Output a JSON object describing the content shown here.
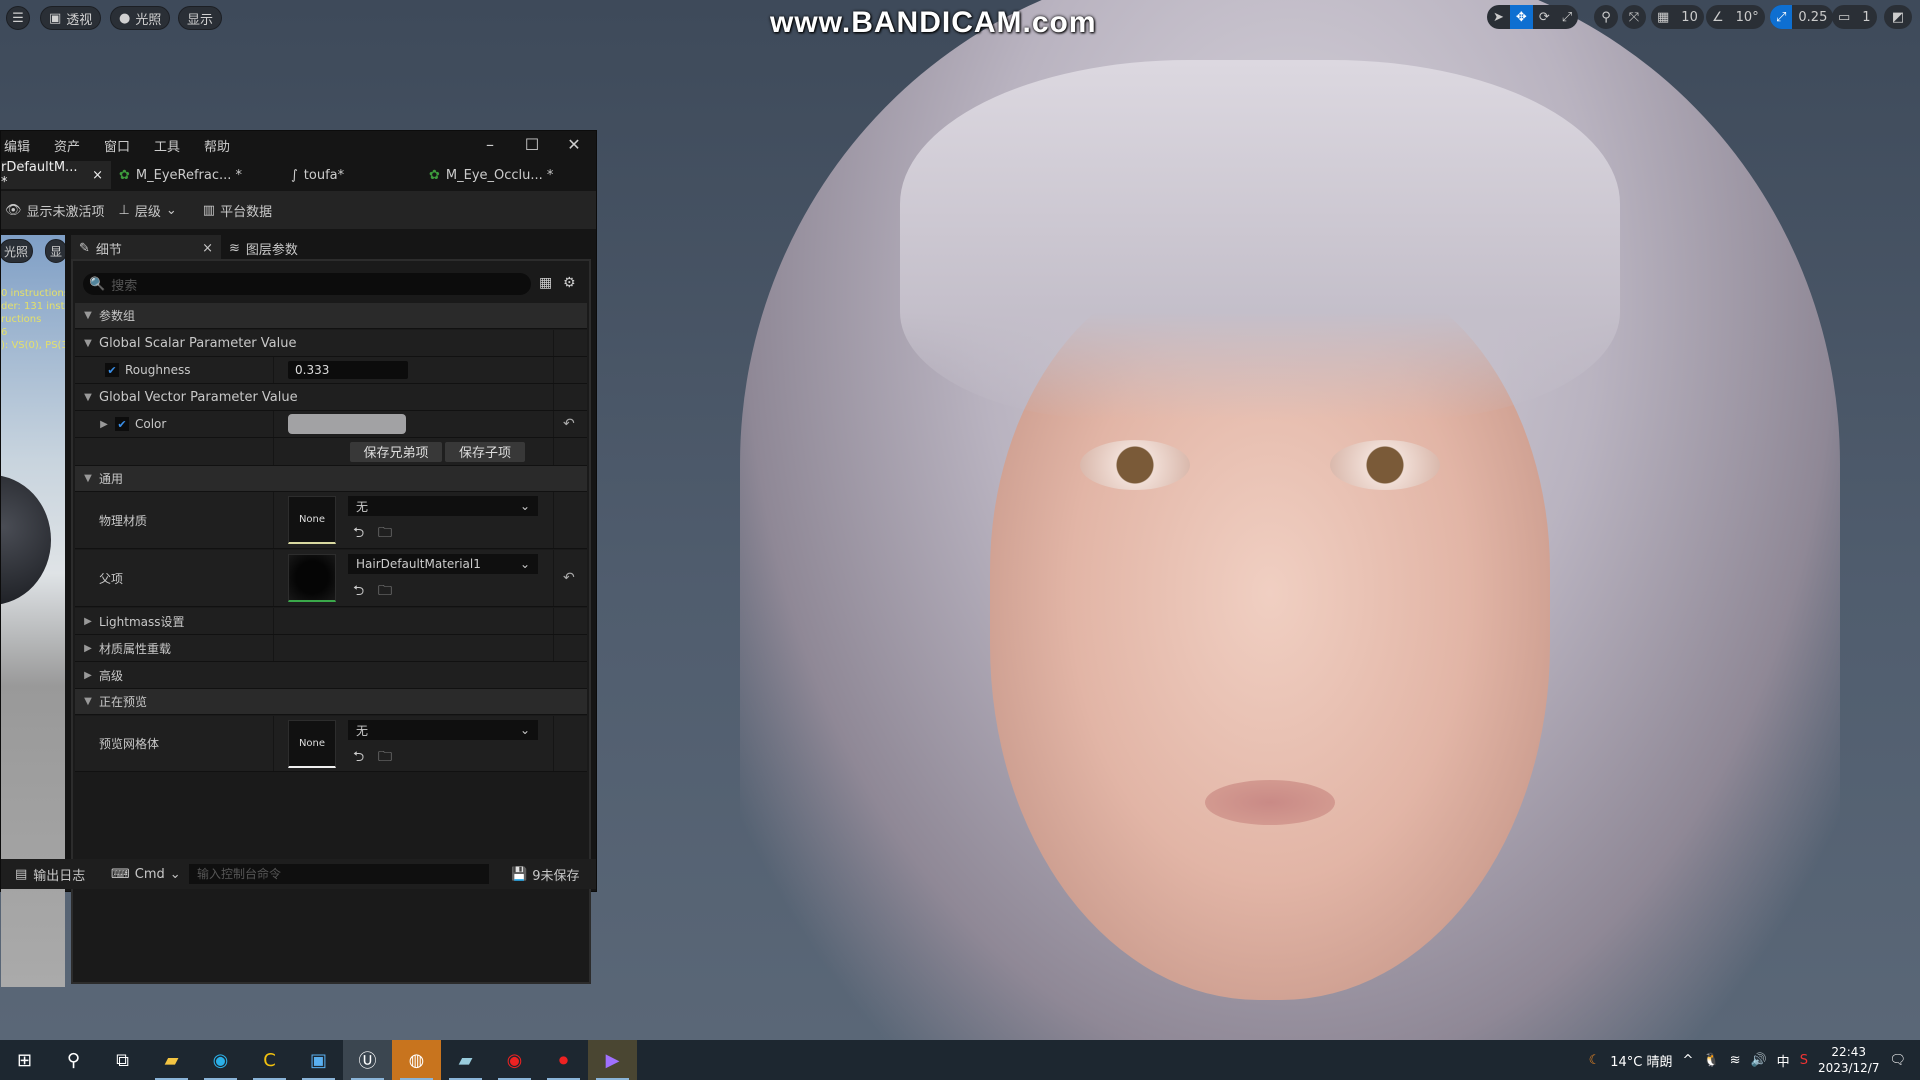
{
  "viewport": {
    "toolbar_left": {
      "menu_icon": "hamburger-icon",
      "perspective": "透视",
      "lighting": "光照",
      "show": "显示"
    },
    "toolbar_right": {
      "grid_snap": "10",
      "angle_snap": "10°",
      "scale_snap": "0.25",
      "camera_speed": "1"
    },
    "watermark": "www.BANDICAM.com"
  },
  "window": {
    "menu": [
      "编辑",
      "资产",
      "窗口",
      "工具",
      "帮助"
    ],
    "tabs": [
      {
        "label": "rDefaultM... *",
        "active": true
      },
      {
        "label": "M_EyeRefrac... *",
        "active": false
      },
      {
        "label": "toufa*",
        "active": false
      },
      {
        "label": "M_Eye_Occlu... *",
        "active": false
      }
    ],
    "toolbar": {
      "show_inactive": "显示未激活项",
      "hierarchy": "层级",
      "platform_stats": "平台数据"
    },
    "preview": {
      "lighting": "光照",
      "show": "显",
      "stats": [
        "0 instructions",
        "der: 131 instr",
        "ructions",
        "6",
        "): VS(0), PS(3"
      ]
    },
    "details_tabs": {
      "details": "细节",
      "layer_params": "图层参数"
    },
    "search_placeholder": "搜索",
    "sections": {
      "param_groups": "参数组",
      "global_scalar": "Global Scalar Parameter Value",
      "roughness_label": "Roughness",
      "roughness_value": "0.333",
      "global_vector": "Global Vector Parameter Value",
      "color_label": "Color",
      "color_value": "#a2a2a4",
      "save_sibling": "保存兄弟项",
      "save_child": "保存子项",
      "general": "通用",
      "phys_material": "物理材质",
      "phys_thumb": "None",
      "phys_value": "无",
      "parent": "父项",
      "parent_value": "HairDefaultMaterial1",
      "lightmass": "Lightmass设置",
      "mat_override": "材质属性重载",
      "advanced": "高级",
      "previewing": "正在预览",
      "preview_mesh": "预览网格体",
      "preview_thumb": "None",
      "preview_value": "无"
    },
    "bottom": {
      "output_log": "输出日志",
      "cmd": "Cmd",
      "console_placeholder": "输入控制台命令",
      "unsaved": "9未保存"
    }
  },
  "taskbar": {
    "weather": "14°C 晴朗",
    "ime": "中",
    "time": "22:43",
    "date": "2023/12/7"
  }
}
